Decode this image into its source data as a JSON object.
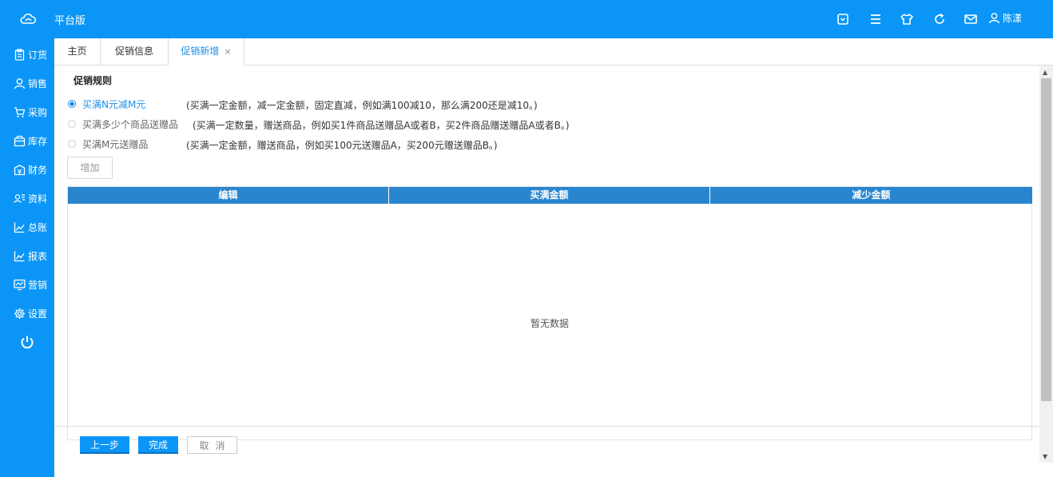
{
  "header": {
    "brand": "平台版",
    "icons": [
      "dropdown-box-icon",
      "menu-icon",
      "shirt-icon",
      "refresh-icon",
      "mail-icon",
      "user-icon"
    ],
    "user_name": "陈漾"
  },
  "sidebar": {
    "items": [
      {
        "label": "订货",
        "icon": "order-doc-icon"
      },
      {
        "label": "销售",
        "icon": "sales-person-icon"
      },
      {
        "label": "采购",
        "icon": "cart-icon"
      },
      {
        "label": "库存",
        "icon": "inventory-box-icon"
      },
      {
        "label": "财务",
        "icon": "finance-icon"
      },
      {
        "label": "资料",
        "icon": "profile-card-icon"
      },
      {
        "label": "总账",
        "icon": "ledger-chart-icon"
      },
      {
        "label": "报表",
        "icon": "report-chart-icon"
      },
      {
        "label": "营销",
        "icon": "marketing-monitor-icon"
      },
      {
        "label": "设置",
        "icon": "gear-icon"
      }
    ],
    "power_icon": "power-icon"
  },
  "tabs": [
    {
      "label": "主页"
    },
    {
      "label": "促销信息"
    },
    {
      "label": "促销新增",
      "close": "×"
    }
  ],
  "promo": {
    "section_title": "促销规则",
    "options": [
      {
        "label": "买满N元减M元",
        "desc": "(买满一定金额，减一定金额，固定直减，例如满100减10，那么满200还是减10。)",
        "checked": true
      },
      {
        "label": "买满多少个商品送赠品",
        "desc": "(买满一定数量，赠送商品，例如买1件商品送赠品A或者B，买2件商品赠送赠品A或者B。)",
        "checked": false
      },
      {
        "label": "买满M元送赠品",
        "desc": "(买满一定金额，赠送商品，例如买100元送赠品A，买200元赠送赠品B。)",
        "checked": false
      }
    ],
    "add_label": "增加"
  },
  "table": {
    "columns": [
      "编辑",
      "买满金额",
      "减少金额"
    ],
    "empty_text": "暂无数据"
  },
  "footer": {
    "prev_label": "上一步",
    "finish_label": "完成",
    "cancel_label": "取消"
  },
  "colors": {
    "brand_blue": "#0b96f7",
    "table_header": "#2a85cf",
    "active_tab": "#1e90e8"
  }
}
